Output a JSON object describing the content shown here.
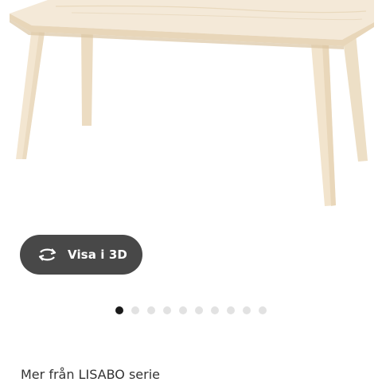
{
  "product_image": {
    "alt": "LISABO coffee table"
  },
  "view_3d": {
    "label": "Visa i 3D",
    "icon": "rotate-360-icon"
  },
  "carousel": {
    "total_images": 10,
    "active_index": 0
  },
  "more_from_series": {
    "text": "Mer från LISABO serie"
  },
  "colors": {
    "button_bg": "#484848",
    "dot_active": "#1a1a1a",
    "dot_inactive": "#e2e2e2",
    "wood": "#f1e3cc"
  }
}
